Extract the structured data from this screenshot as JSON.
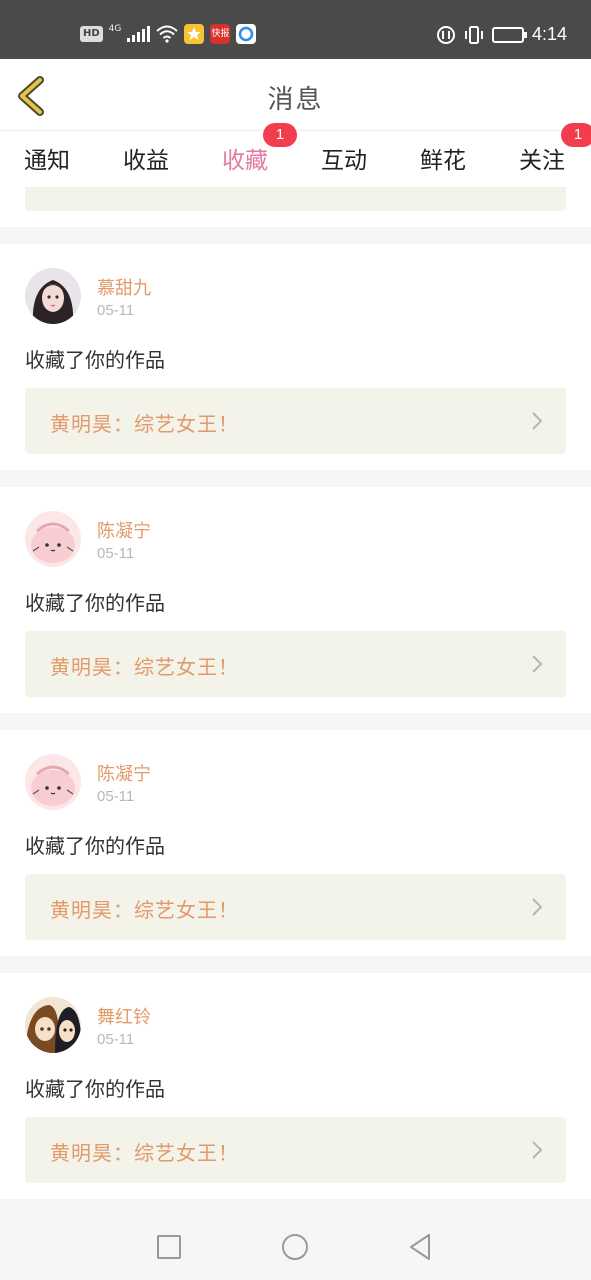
{
  "status_bar": {
    "hd": "HD",
    "network": "4G",
    "time": "4:14",
    "icons": [
      "hd-icon",
      "signal-icon",
      "wifi-icon",
      "star-app-icon",
      "kuaibao-app-icon",
      "browser-app-icon",
      "data-saver-icon",
      "vibrate-icon",
      "battery-icon"
    ],
    "app_badge_text": "快报"
  },
  "header": {
    "title": "消息",
    "back_icon": "chevron-left-icon"
  },
  "tabs": [
    {
      "label": "通知",
      "active": false,
      "badge": ""
    },
    {
      "label": "收益",
      "active": false,
      "badge": ""
    },
    {
      "label": "收藏",
      "active": true,
      "badge": "1"
    },
    {
      "label": "互动",
      "active": false,
      "badge": ""
    },
    {
      "label": "鲜花",
      "active": false,
      "badge": ""
    },
    {
      "label": "关注",
      "active": false,
      "badge": "1"
    }
  ],
  "messages": [
    {
      "user": "慕甜九",
      "date": "05-11",
      "action": "收藏了你的作品",
      "work": "黄明昊：综艺女王！",
      "avatar": "girl-portrait-avatar"
    },
    {
      "user": "陈凝宁",
      "date": "05-11",
      "action": "收藏了你的作品",
      "work": "黄明昊：综艺女王！",
      "avatar": "pink-blob-avatar"
    },
    {
      "user": "陈凝宁",
      "date": "05-11",
      "action": "收藏了你的作品",
      "work": "黄明昊：综艺女王！",
      "avatar": "pink-blob-avatar"
    },
    {
      "user": "舞红铃",
      "date": "05-11",
      "action": "收藏了你的作品",
      "work": "黄明昊：综艺女王！",
      "avatar": "anime-pair-avatar"
    }
  ],
  "nav_bar": {
    "icons": [
      "recents-square-icon",
      "home-circle-icon",
      "back-triangle-icon"
    ]
  },
  "colors": {
    "accent": "#e37aa3",
    "name": "#e39a6a",
    "badge": "#f23d4d",
    "card_bg": "#f3f3ea",
    "status_bar": "#4a4a4a"
  }
}
